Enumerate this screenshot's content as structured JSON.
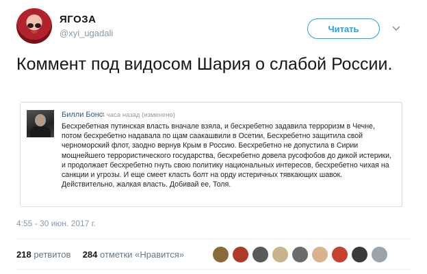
{
  "author": {
    "name": "ЯГОЗА",
    "handle": "@xyi_ugadali",
    "follow_label": "Читать"
  },
  "tweet": {
    "text": "Коммент под видосом Шария о слабой России.",
    "timestamp": "4:55 - 30 июн. 2017 г."
  },
  "embedded_comment": {
    "author": "Билли Бонс",
    "meta": "4 часа назад (изменено)",
    "body": "Бесхребетная путинская власть вначале взяла, и бесхребетно задавила терроризм в Чечне, потом бесхребетно надавала по щам саакашвили в Осетии, Бесхребетно защитила свой черноморский флот, заодно вернув Крым в Россию. Бесхребетно не допустила в Сирии мощнейшего террористического государства, бесхребетно довела русофобов до дикой истерики, и продолжает бесхребетно гнуть свою политику национальных интересов, бесхребетно чихая на санкции и угрозы. И еще смеет класть болт на орду истеричных тявкающих шавок. Действительно, жалкая власть. Добивай ее, Толя."
  },
  "stats": {
    "retweets_count": "218",
    "retweets_label": "ретвитов",
    "likes_count": "284",
    "likes_label": "отметки «Нравится»"
  },
  "colors": {
    "accent": "#1da1f2",
    "muted": "#8899a6",
    "link": "#2b587a"
  },
  "likers": [
    {
      "color": "#8a6a3a"
    },
    {
      "color": "#b03a2a"
    },
    {
      "color": "#5a5a5a"
    },
    {
      "color": "#c9b48a"
    },
    {
      "color": "#6b6b6b"
    },
    {
      "color": "#d9b38c"
    },
    {
      "color": "#c8402e"
    },
    {
      "color": "#3a3a3a"
    },
    {
      "color": "#9aa4ad"
    }
  ]
}
